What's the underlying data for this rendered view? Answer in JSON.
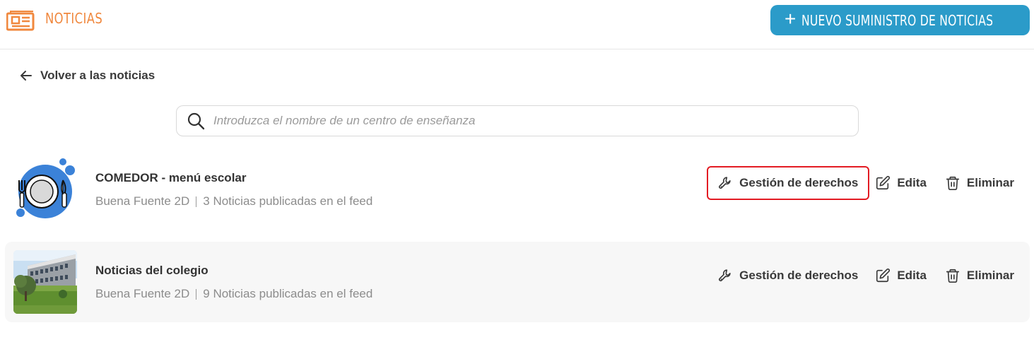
{
  "header": {
    "app_icon": "newspaper-icon",
    "title": "NOTICIAS",
    "new_feed_label": "NUEVO SUMINISTRO DE NOTICIAS",
    "new_feed_icon": "plus-icon",
    "accent_color": "#f0883e",
    "button_color": "#2b9bc9"
  },
  "back": {
    "label": "Volver a las noticias",
    "icon": "arrow-left-icon"
  },
  "search": {
    "placeholder": "Introduzca el nombre de un centro de enseñanza",
    "value": "",
    "icon": "search-icon"
  },
  "feeds": [
    {
      "title": "COMEDOR - menú escolar",
      "school": "Buena Fuente 2D",
      "count_text": "3 Noticias publicadas en el feed",
      "thumb": "dining-plate-icon",
      "actions": {
        "rights": "Gestión de derechos",
        "edit": "Edita",
        "delete": "Eliminar"
      },
      "highlighted_action": "rights"
    },
    {
      "title": "Noticias del colegio",
      "school": "Buena Fuente 2D",
      "count_text": "9 Noticias publicadas en el feed",
      "thumb": "school-building-photo",
      "actions": {
        "rights": "Gestión de derechos",
        "edit": "Edita",
        "delete": "Eliminar"
      }
    }
  ],
  "highlight_color": "#e31b23"
}
